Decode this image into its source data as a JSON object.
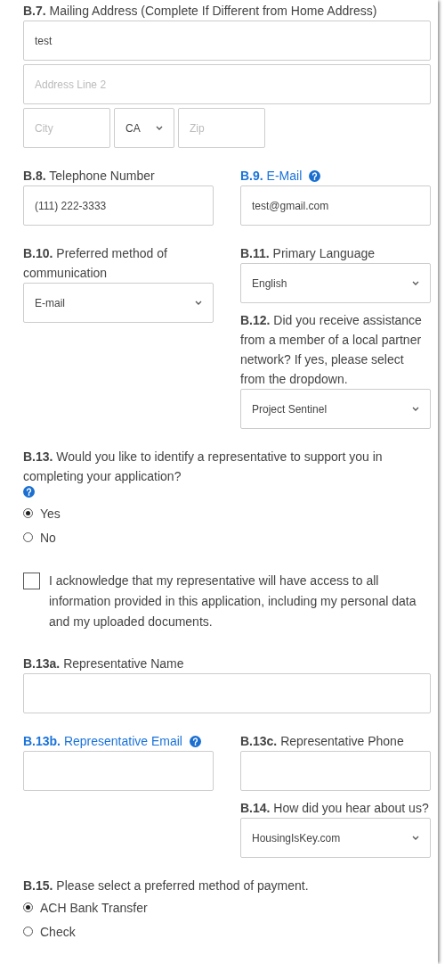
{
  "sections": [
    {
      "kind": "address",
      "label": "**B.7.** Mailing Address (Complete If Different from Home Address)",
      "line1": {
        "value": "test"
      },
      "line2": {
        "placeholder": "Address Line 2"
      },
      "city": {
        "placeholder": "City"
      },
      "state": {
        "value": "CA"
      },
      "zip": {
        "placeholder": "Zip"
      }
    },
    {
      "kind": "columns",
      "left": [
        {
          "label": "**B.8.** Telephone Number",
          "linked": false,
          "help": false,
          "kind": "text",
          "value": "(111) 222-3333"
        }
      ],
      "right": [
        {
          "label": "**B.9.** E-Mail",
          "linked": true,
          "help": true,
          "kind": "text",
          "value": "test@gmail.com"
        }
      ]
    },
    {
      "kind": "columns",
      "left": [
        {
          "label": "**B.10.** Preferred method of communication",
          "linked": false,
          "help": false,
          "kind": "select",
          "value": "E-mail"
        }
      ],
      "right": [
        {
          "label": "**B.11.** Primary Language",
          "linked": false,
          "help": false,
          "kind": "select",
          "value": "English"
        },
        {
          "label": "**B.12.** Did you receive assistance from a member of a local partner network? If yes, please select from the dropdown.",
          "linked": false,
          "help": false,
          "kind": "select",
          "value": "Project Sentinel"
        }
      ]
    },
    {
      "kind": "radio",
      "label": "**B.13.** Would you like to identify a representative to support you in completing your application?",
      "help": true,
      "options": [
        {
          "label": "Yes",
          "selected": true
        },
        {
          "label": "No",
          "selected": false
        }
      ]
    },
    {
      "kind": "checkbox",
      "text": "I acknowledge that my representative will have access to all information provided in this application, including my personal data and my uploaded documents.",
      "checked": false
    },
    {
      "kind": "field",
      "label": "**B.13a.** Representative Name",
      "linked": false,
      "help": false
    },
    {
      "kind": "columns",
      "left": [
        {
          "label": "**B.13b.** Representative Email",
          "linked": true,
          "help": true,
          "kind": "text"
        }
      ],
      "right": [
        {
          "label": "**B.13c.** Representative Phone",
          "linked": false,
          "help": false,
          "kind": "text"
        },
        {
          "label": "**B.14.** How did you hear about us?",
          "linked": false,
          "help": false,
          "kind": "select",
          "value": "HousingIsKey.com"
        }
      ]
    },
    {
      "kind": "radio",
      "label": "**B.15.** Please select a preferred method of payment.",
      "help": false,
      "options": [
        {
          "label": "ACH Bank Transfer",
          "selected": true
        },
        {
          "label": "Check",
          "selected": false
        }
      ]
    }
  ]
}
